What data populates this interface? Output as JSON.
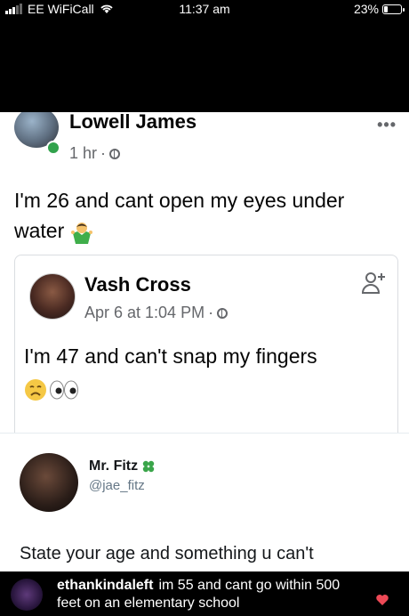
{
  "status_bar": {
    "carrier": "EE WiFiCall",
    "time": "11:37 am",
    "battery": "23%",
    "battery_level": 0.23
  },
  "post": {
    "author": "Lowell James",
    "time": "1 hr",
    "text": "I'm 26 and cant open my eyes under water",
    "more": "•••"
  },
  "shared_post": {
    "author": "Vash Cross",
    "time": "Apr 6 at 1:04 PM",
    "text": "I'm 47 and can't snap my fingers",
    "emojis": [
      "😩",
      "👀"
    ]
  },
  "tweet": {
    "name": "Mr. Fitz",
    "handle": "@jae_fitz",
    "text": "State your age and something u can't"
  },
  "comment": {
    "user": "ethankindaleft",
    "text": "im 55 and cant go within 500 feet on an elementary school"
  },
  "colors": {
    "online": "#31a24c",
    "heart": "#ed4956",
    "clover": "#3aa54a"
  }
}
